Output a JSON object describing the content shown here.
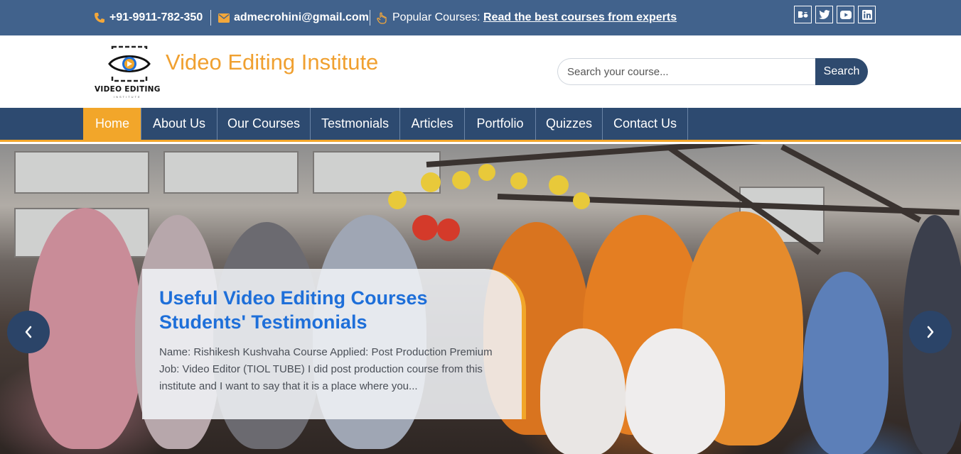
{
  "topbar": {
    "phone": "+91-9911-782-350",
    "email": "admecrohini@gmail.com",
    "popular_label": "Popular Courses:",
    "popular_link": "Read the best courses from experts",
    "social_icons": [
      "behance-icon",
      "twitter-icon",
      "youtube-icon",
      "linkedin-icon"
    ],
    "background": "#41628c",
    "icon_color": "#f2a73b"
  },
  "header": {
    "logo_text": "VIDEO EDITING",
    "logo_subtext": "INSTITUTE",
    "site_title": "Video Editing Institute",
    "title_color": "#f0a030",
    "search": {
      "placeholder": "Search your course...",
      "value": "",
      "button_label": "Search"
    }
  },
  "nav": {
    "items": [
      {
        "label": "Home",
        "active": true
      },
      {
        "label": "About Us"
      },
      {
        "label": "Our Courses"
      },
      {
        "label": "Testmonials"
      },
      {
        "label": "Articles"
      },
      {
        "label": "Portfolio"
      },
      {
        "label": "Quizzes"
      },
      {
        "label": "Contact Us"
      }
    ],
    "background": "#2d4a70",
    "accent": "#f2a62a"
  },
  "hero": {
    "caption_title": "Useful Video Editing Courses Students' Testimonials",
    "caption_text": "Name: Rishikesh Kushvaha Course Applied: Post Production Premium Job: Video Editor (TIOL TUBE) I did post production course from this institute and I want to say that it is a place where you...",
    "title_color": "#1e6fd9",
    "prev_icon": "chevron-left-icon",
    "next_icon": "chevron-right-icon"
  }
}
